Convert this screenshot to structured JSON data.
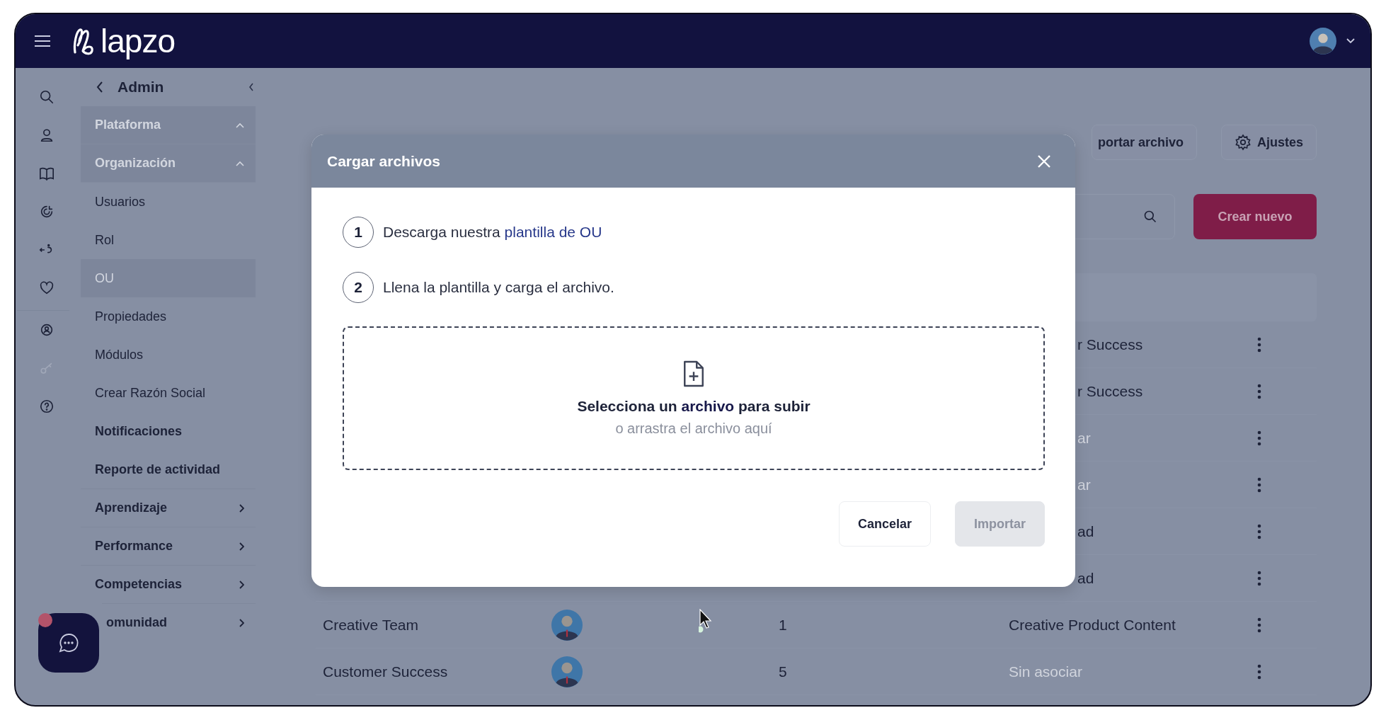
{
  "header": {
    "logo": "lapzo"
  },
  "rail": [
    {
      "kind": "search",
      "disabled": false
    },
    {
      "kind": "user",
      "disabled": false
    },
    {
      "kind": "book",
      "disabled": false
    },
    {
      "kind": "target",
      "disabled": false
    },
    {
      "kind": "swap",
      "disabled": false
    },
    {
      "kind": "heart",
      "disabled": false
    },
    {
      "kind": "team",
      "disabled": false
    },
    {
      "kind": "key",
      "disabled": true
    },
    {
      "kind": "help",
      "disabled": false
    }
  ],
  "sidebar": {
    "title": "Admin",
    "items": [
      {
        "label": "Plataforma",
        "kind": "section",
        "selected": true
      },
      {
        "label": "Organización",
        "kind": "section",
        "selected": true
      },
      {
        "label": "Usuarios",
        "kind": "link",
        "selected": false
      },
      {
        "label": "Rol",
        "kind": "link",
        "selected": false
      },
      {
        "label": "OU",
        "kind": "link",
        "selected": true
      },
      {
        "label": "Propiedades",
        "kind": "link",
        "selected": false
      },
      {
        "label": "Módulos",
        "kind": "link",
        "selected": false
      },
      {
        "label": "Crear Razón Social",
        "kind": "link",
        "selected": false
      },
      {
        "label": "Notificaciones",
        "kind": "bold",
        "selected": false
      },
      {
        "label": "Reporte de actividad",
        "kind": "bold",
        "selected": false
      },
      {
        "label": "Aprendizaje",
        "kind": "group",
        "selected": false
      },
      {
        "label": "Performance",
        "kind": "group",
        "selected": false
      },
      {
        "label": "Competencias",
        "kind": "group",
        "selected": false
      },
      {
        "label": "omunidad",
        "kind": "group-covered",
        "selected": false
      }
    ]
  },
  "toolbar": {
    "import_button": "portar archivo",
    "settings_button": "Ajustes",
    "create_button": "Crear nuevo"
  },
  "table": {
    "rows": [
      {
        "association": "r Success",
        "muted": false
      },
      {
        "association": "r Success",
        "muted": false
      },
      {
        "association": "ar",
        "muted": true
      },
      {
        "association": "ar",
        "muted": true
      },
      {
        "association": "ad",
        "muted": false
      },
      {
        "association": "ad",
        "muted": false
      },
      {
        "name": "Creative Team",
        "count": "1",
        "association": "Creative Product Content",
        "muted": false
      },
      {
        "name": "Customer Success",
        "count": "5",
        "association": "Sin asociar",
        "muted": true
      }
    ]
  },
  "chat": {
    "unread": true
  },
  "modal": {
    "title": "Cargar archivos",
    "steps": [
      {
        "number": "1",
        "text": "Descarga nuestra ",
        "link": "plantilla de OU"
      },
      {
        "number": "2",
        "text": "Llena la plantilla y carga el archivo."
      }
    ],
    "dropzone": {
      "title": "Selecciona un **archivo** para subir",
      "hint": "o arrastra el archivo aquí"
    },
    "buttons": [
      {
        "label": "Cancelar",
        "disabled": false
      },
      {
        "label": "Importar",
        "disabled": true
      }
    ]
  }
}
